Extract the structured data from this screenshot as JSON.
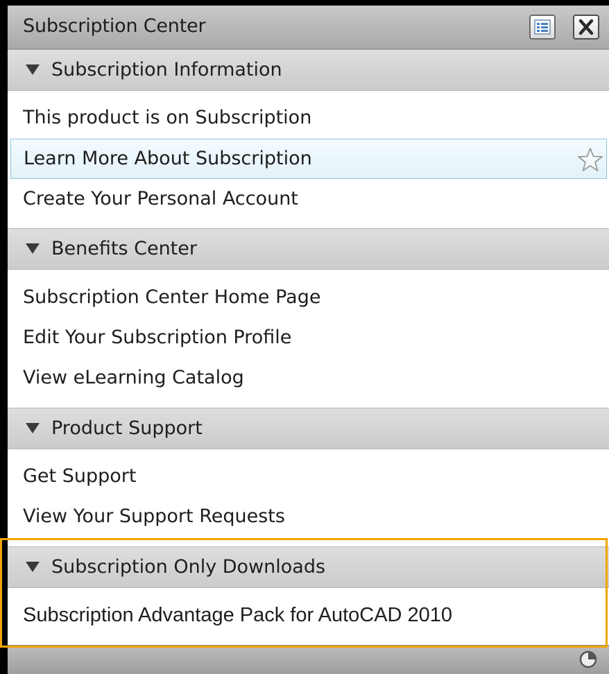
{
  "window": {
    "title": "Subscription Center",
    "options_icon": "list-options-icon",
    "close_icon": "close-icon"
  },
  "sections": [
    {
      "label": "Subscription Information",
      "items": [
        "This product is on Subscription",
        "Learn More About Subscription",
        "Create Your Personal Account"
      ]
    },
    {
      "label": "Benefits Center",
      "items": [
        "Subscription Center Home Page",
        "Edit Your Subscription Profile",
        "View eLearning Catalog"
      ]
    },
    {
      "label": "Product Support",
      "items": [
        "Get Support",
        "View Your Support Requests"
      ]
    },
    {
      "label": "Subscription Only Downloads",
      "items": [
        "Subscription Advantage Pack for AutoCAD 2010"
      ]
    }
  ],
  "hovered_item_icon": "star-icon",
  "colors": {
    "highlight_frame": "#f0a500",
    "hover_border": "#8fc3dc"
  }
}
